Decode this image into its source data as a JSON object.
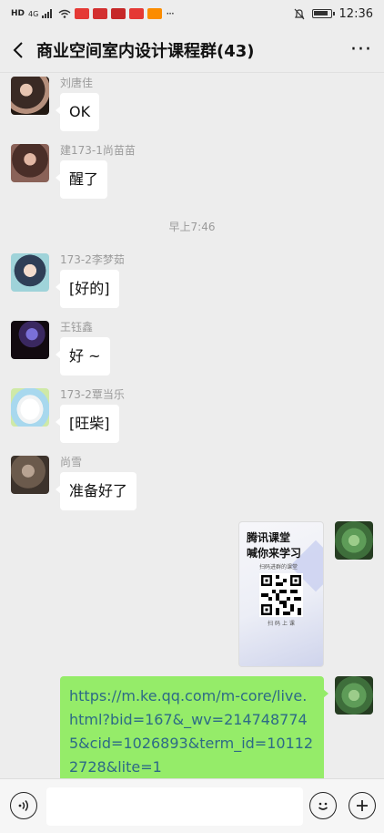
{
  "status_bar": {
    "left_indicators": [
      "HD",
      "4G"
    ],
    "time": "12:36"
  },
  "header": {
    "title": "商业空间室内设计课程群(43)",
    "back_icon": "chevron-left-icon",
    "more_icon": "more-dots-icon",
    "more_label": "···"
  },
  "messages": [
    {
      "sender": "刘唐佳",
      "text": "OK"
    },
    {
      "sender": "建173-1尚苗苗",
      "text": "醒了"
    },
    {
      "sender": "173-2李梦茹",
      "text": "[好的]"
    },
    {
      "sender": "王钰鑫",
      "text": "好 ~"
    },
    {
      "sender": "173-2覃当乐",
      "text": "[旺柴]"
    },
    {
      "sender": "尚雪",
      "text": "准备好了"
    }
  ],
  "timestamp": "早上7:46",
  "self_image_card": {
    "title": "腾讯课堂\n喊你来学习",
    "subtitle": "扫码进群的课堂",
    "scan_text": "扫 码 上 课"
  },
  "self_link": {
    "text": "https://m.ke.qq.com/m-core/live.html?bid=167&_wv=2147487745&cid=1026893&term_id=101122728&lite=1"
  },
  "bottom_bar": {
    "voice_icon": "voice-icon",
    "emoji_icon": "emoji-icon",
    "plus_icon": "plus-icon",
    "input_value": ""
  },
  "colors": {
    "background": "#ededed",
    "incoming_bubble": "#ffffff",
    "outgoing_bubble": "#95ec69",
    "link": "#2d6a86",
    "meta_text": "#9b9b9b"
  }
}
